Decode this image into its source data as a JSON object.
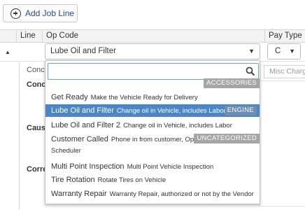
{
  "toolbar": {
    "add_job_line_label": "Add Job Line"
  },
  "table": {
    "headers": {
      "line": "Line",
      "op_code": "Op Code",
      "pay_type": "Pay Type"
    },
    "row": {
      "op_code_value": "Lube Oil and Filter",
      "pay_type_value": "C"
    }
  },
  "detail": {
    "concern_top": "Conce",
    "concern_label": "Conc",
    "cause_label": "Caus",
    "correction_label": "Corre",
    "misc_placeholder": "Misc Charg"
  },
  "dropdown": {
    "search_value": "",
    "groups": {
      "accessories": "ACCESSORIES",
      "engine": "ENGINE",
      "uncategorized": "UNCATEGORIZED"
    },
    "items": [
      {
        "name": "Get Ready",
        "desc": "Make the Vehicle Ready for Delivery"
      },
      {
        "name": "Lube Oil and Filter",
        "desc": "Change oil in Vehicle, includes Labor"
      },
      {
        "name": "Lube Oil and Filter 2",
        "desc": "Change oil in Vehicle, includes Labor"
      },
      {
        "name": "Customer Called",
        "desc": "Phone in from customer, Open Co",
        "desc2": "Scheduler"
      },
      {
        "name": "Multi Point Inspection",
        "desc": "Multi Point Vehicle Inspection"
      },
      {
        "name": "Tire Rotation",
        "desc": "Rotate Tires on Vehicle"
      },
      {
        "name": "Warranty Repair",
        "desc": "Warranty Repair, authorized or not by the Vendor"
      }
    ],
    "selected_index": 1
  },
  "icons": {
    "add": "plus-circle-icon",
    "search": "search-icon",
    "expand": "caret-icon",
    "dropdown": "chevron-down-icon"
  },
  "colors": {
    "selected_bg": "#4a86c8",
    "search_border": "#6ba4d8",
    "group_bg": "#a5a5a5",
    "link": "#2a4d8f"
  }
}
